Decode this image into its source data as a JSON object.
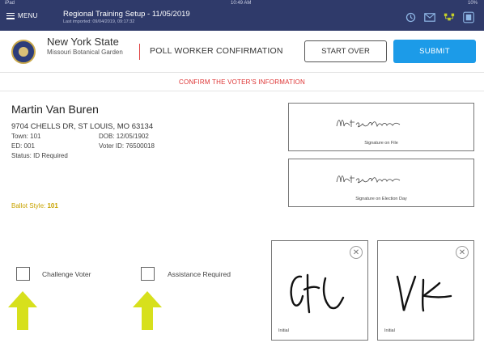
{
  "status_bar": {
    "left": "iPad",
    "time": "10:49 AM",
    "right": "10%"
  },
  "navbar": {
    "menu_label": "MENU",
    "title": "Regional Training Setup - 11/05/2019",
    "subtitle": "Last imported: 09/04/2019, 09:17:32",
    "icons": [
      "history-icon",
      "mail-icon",
      "network-icon",
      "poll-book-icon"
    ]
  },
  "header": {
    "state": "New York State",
    "location": "Missouri Botanical Garden",
    "screen_title": "POLL WORKER CONFIRMATION",
    "start_over_label": "START OVER",
    "submit_label": "SUBMIT"
  },
  "banner": "CONFIRM THE VOTER'S INFORMATION",
  "voter": {
    "name": "Martin Van Buren",
    "address": "9704 CHELLS DR, ST LOUIS, MO 63134",
    "town": "Town: 101",
    "ed": "ED: 001",
    "status": "Status: ID Required",
    "dob": "DOB: 12/05/1902",
    "voter_id": "Voter ID: 76500018",
    "ballot_style_label": "Ballot Style:",
    "ballot_style_value": "101"
  },
  "signatures": {
    "on_file_caption": "Signature on File",
    "election_day_caption": "Signature on Election Day"
  },
  "initials": [
    {
      "caption": "Initial"
    },
    {
      "caption": "Initial"
    }
  ],
  "checkboxes": {
    "challenge_label": "Challenge Voter",
    "assistance_label": "Assistance Required"
  },
  "colors": {
    "navbar": "#2f3a6a",
    "submit": "#1c9be8",
    "banner_text": "#dd3333",
    "ballot_style": "#c8a300",
    "arrow": "#d7e01c"
  }
}
